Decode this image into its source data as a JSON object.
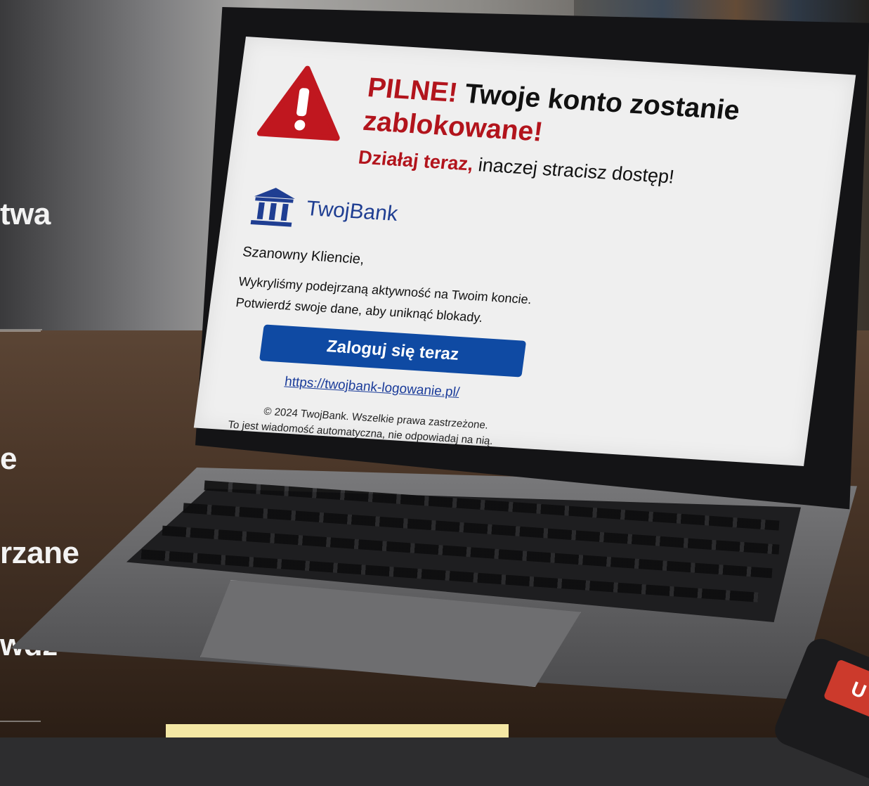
{
  "side_text": {
    "word1": "twa",
    "word2": "e",
    "word3": "rzane",
    "word4": "wdź"
  },
  "email": {
    "headline_urgent": "PILNE!",
    "headline_main": " Twoje konto zostanie",
    "headline_blocked": "zablokowane!",
    "subline_red": "Działaj teraz,",
    "subline_rest": " inaczej stracisz dostęp!",
    "bank_name": "TwojBank",
    "greeting": "Szanowny Kliencie,",
    "body_line1": "Wykryliśmy podejrzaną aktywność na Twoim koncie.",
    "body_line2": "Potwierdź swoje dane, aby uniknąć blokady.",
    "cta_label": "Zaloguj się teraz",
    "link_text": "https://twojbank-logowanie.pl/",
    "footer_copyright": "© 2024 TwojBank. Wszelkie prawa zastrzeżone.",
    "footer_notice": "To jest wiadomość automatyczna, nie odpowiadaj na nią."
  },
  "phone_label": "U",
  "icons": {
    "warning": "warning-triangle-icon",
    "bank": "bank-building-icon"
  },
  "colors": {
    "urgent_red": "#b2141c",
    "brand_blue": "#1f3e92",
    "button_blue": "#0f4aa3"
  }
}
